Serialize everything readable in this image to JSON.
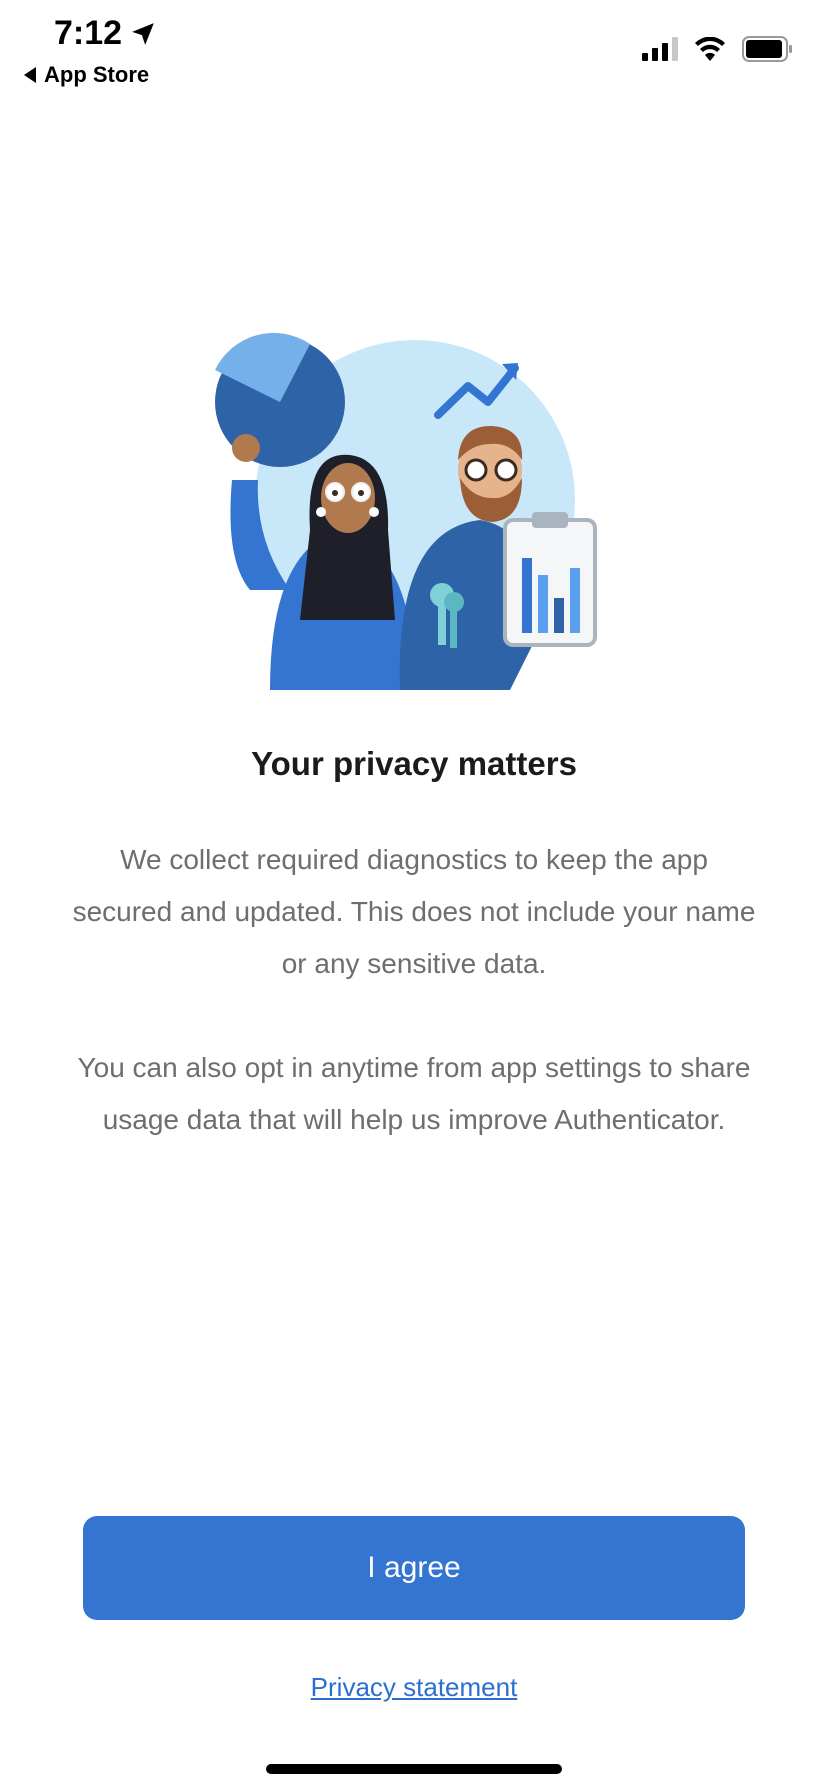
{
  "status_bar": {
    "time": "7:12",
    "back_label": "App Store",
    "icons": [
      "location-arrow-icon",
      "cellular-signal-icon",
      "wifi-icon",
      "battery-icon"
    ]
  },
  "illustration": {
    "description_icon": "privacy-illustration-icon",
    "colors": {
      "primary_blue": "#3375d0",
      "light_blue_circle": "#c8e8fa",
      "pie_dark": "#2f63a8",
      "pie_light": "#76b0ea"
    }
  },
  "content": {
    "title": "Your privacy matters",
    "paragraph_1": "We collect required diagnostics to keep the app secured and updated. This does not include your name or any sensitive data.",
    "paragraph_2": "You can also opt in anytime from app settings to share usage data that will help us improve Authenticator."
  },
  "actions": {
    "agree_label": "I agree",
    "privacy_link": "Privacy statement",
    "accent_color": "#3375d0"
  }
}
